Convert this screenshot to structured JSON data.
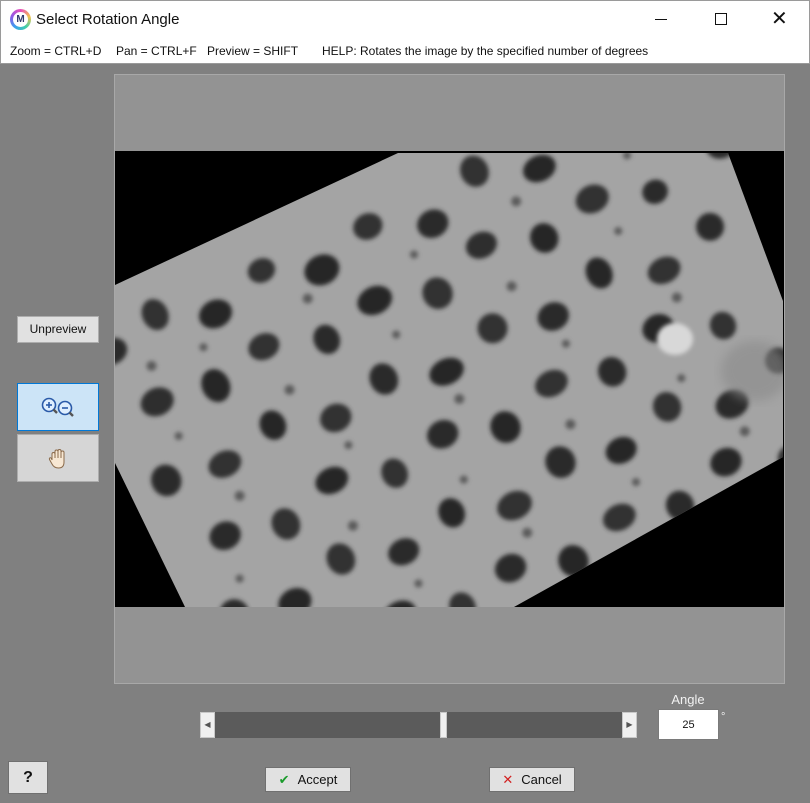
{
  "window": {
    "title": "Select Rotation Angle",
    "icon_letter": "M"
  },
  "hints": {
    "zoom": "Zoom = CTRL+D",
    "pan": "Pan = CTRL+F",
    "preview": "Preview = SHIFT",
    "help": "HELP:  Rotates the image by the specified number of degrees"
  },
  "sidebar": {
    "unpreview_label": "Unpreview",
    "zoom_tool_icon": "zoom-in-out-icon",
    "pan_tool_icon": "hand-pan-icon"
  },
  "angle": {
    "label": "Angle",
    "value": "25",
    "unit": "°"
  },
  "slider": {
    "position_fraction": 0.56
  },
  "buttons": {
    "help": "?",
    "accept": "Accept",
    "cancel": "Cancel"
  },
  "colors": {
    "accent": "#0078d7",
    "accept_check": "#1a9b2b",
    "cancel_x": "#d22020"
  }
}
